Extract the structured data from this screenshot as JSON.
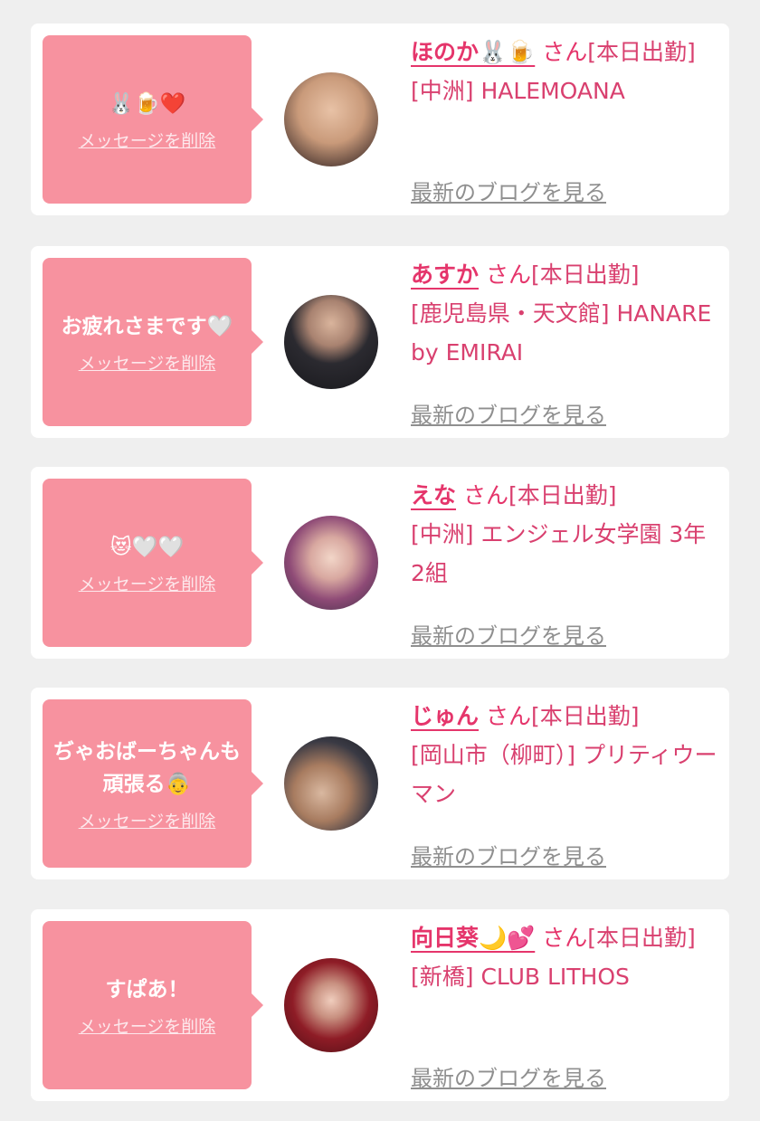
{
  "delete_label": "メッセージを削除",
  "san_label": "さん",
  "blog_label": "最新のブログを見る",
  "cards": [
    {
      "message": "🐰🍺❤️",
      "name": "ほのか🐰🍺",
      "status": "[本日出勤]",
      "shop": "[中洲] HALEMOANA"
    },
    {
      "message": "お疲れさまです🤍",
      "name": "あすか",
      "status": "[本日出勤]",
      "shop": "[鹿児島県・天文館] HANARE by EMIRAI"
    },
    {
      "message": "😻🤍🤍",
      "name": "えな",
      "status": "[本日出勤]",
      "shop": "[中洲] エンジェル女学園 3年2組"
    },
    {
      "message": "ぢゃおばーちゃんも頑張る👵",
      "name": "じゅん",
      "status": "[本日出勤]",
      "shop": "[岡山市（柳町）] プリティウーマン"
    },
    {
      "message": "すぱあ！",
      "name": "向日葵🌙💕",
      "status": "[本日出勤]",
      "shop": "[新橋] CLUB LITHOS"
    }
  ]
}
